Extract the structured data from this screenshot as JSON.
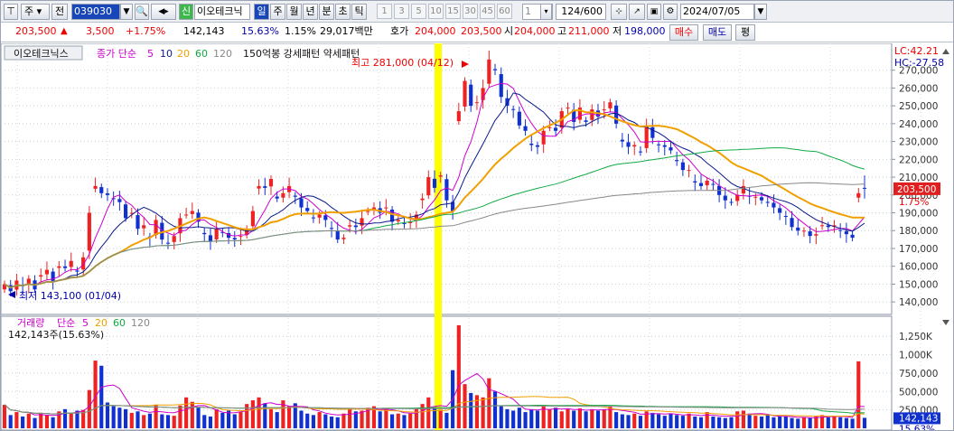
{
  "toolbar": {
    "market": "주",
    "prev": "전",
    "code": "039030",
    "stock_name": "이오테크닉",
    "credit_badge": "신",
    "periods": [
      "일",
      "주",
      "월",
      "년",
      "분",
      "초",
      "틱"
    ],
    "nums": [
      "1",
      "3",
      "5",
      "10",
      "15",
      "30",
      "45",
      "60"
    ],
    "count_input": "1",
    "count": "124",
    "count_total": "/600",
    "date": "2024/07/05"
  },
  "quote": {
    "price": "203,500",
    "arrow": "▲",
    "change": "3,500",
    "change_pct": "+1.75%",
    "volume": "142,143",
    "turnover": "15.63%",
    "ratio": "1.15%",
    "amount": "29,017백만",
    "bid_label": "호가",
    "bid": "204,000",
    "ask": "203,500",
    "open_label": "시",
    "open": "204,000",
    "high_label": "고",
    "high": "211,000",
    "low_label": "저",
    "low": "198,000",
    "buy_label": "매수",
    "sell_label": "매도",
    "eval_label": "평"
  },
  "legend": {
    "name": "이오테크닉스",
    "type": "종가 단순",
    "ma": [
      "5",
      "10",
      "20",
      "60",
      "120"
    ],
    "extra": "150억봉 강세패턴  약세패턴"
  },
  "vol_legend": {
    "name": "거래량",
    "type": "단순",
    "ma": [
      "5",
      "20",
      "60",
      "120"
    ],
    "value": "142,143주(15.63%)"
  },
  "annotations": {
    "high": "최고 281,000 (04/12)",
    "low": "최저 143,100 (01/04)",
    "lc": "LC:42.21",
    "hc": "HC:-27.58",
    "cur_price": "203,500",
    "cur_pct": "1.75%",
    "cur_vol": "142,143",
    "cur_vol_pct": "15.63%"
  },
  "colors": {
    "up": "#ee2222",
    "down": "#1030d0",
    "ma5": "#cc00cc",
    "ma10": "#0a1a8a",
    "ma20": "#f0a000",
    "ma60": "#11aa44",
    "ma120": "#888888",
    "highlight": "#ffff00"
  },
  "chart_data": {
    "type": "candlestick",
    "price_axis": {
      "min": 140000,
      "max": 270000,
      "step": 10000,
      "ticks": [
        "270,000",
        "260,000",
        "250,000",
        "240,000",
        "230,000",
        "220,000",
        "210,000",
        "200,000",
        "190,000",
        "180,000",
        "170,000",
        "160,000",
        "150,000",
        "140,000"
      ]
    },
    "volume_axis": {
      "max": 1250000,
      "ticks": [
        "1,250K",
        "1,000K",
        "750,000",
        "500,000",
        "250,000"
      ]
    },
    "candles": [],
    "volume": [],
    "ma": {}
  }
}
